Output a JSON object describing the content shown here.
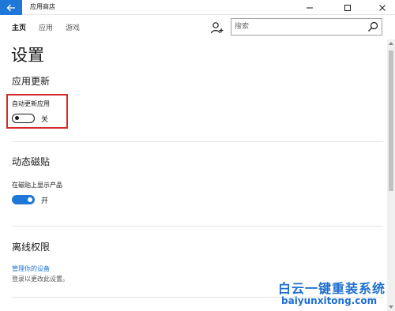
{
  "window": {
    "title": "应用商店",
    "back_icon": "arrow-left-icon",
    "accent": "#1e78d7"
  },
  "nav": {
    "tabs": [
      {
        "label": "主页",
        "active": true
      },
      {
        "label": "应用",
        "active": false
      },
      {
        "label": "游戏",
        "active": false
      }
    ],
    "user_icon": "user-add-icon",
    "search": {
      "value": "",
      "placeholder": "搜索"
    }
  },
  "page": {
    "title": "设置",
    "sections": [
      {
        "title": "应用更新",
        "setting_label": "自动更新应用",
        "toggle": {
          "state": "off",
          "text": "关"
        }
      },
      {
        "title": "动态磁贴",
        "setting_label": "在磁贴上显示产品",
        "toggle": {
          "state": "on",
          "text": "开"
        }
      },
      {
        "title": "离线权限",
        "link": "管理你的设备",
        "description": "登录以更改此设置。"
      }
    ]
  },
  "highlight_color": "#d42a2a",
  "watermark": {
    "line1": "白云一键重装系统",
    "line2": "baiyunxitong.com"
  }
}
